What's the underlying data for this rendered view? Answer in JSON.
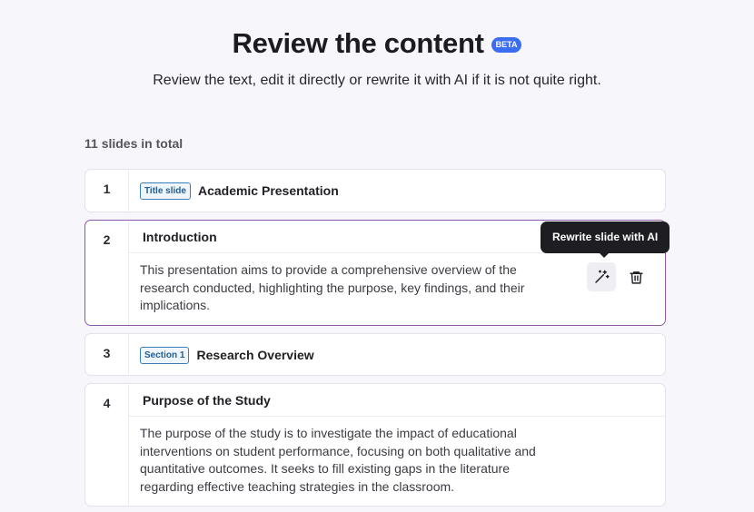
{
  "header": {
    "title": "Review the content",
    "badge": "BETA",
    "subtitle": "Review the text, edit it directly or rewrite it with AI if it is not quite right."
  },
  "slides_count": "11 slides in total",
  "tooltip": "Rewrite slide with AI",
  "slides": [
    {
      "number": "1",
      "tag": "Title slide",
      "title": "Academic Presentation"
    },
    {
      "number": "2",
      "title": "Introduction",
      "body": "This presentation aims to provide a comprehensive overview of the research conducted, highlighting the purpose, key findings, and their implications."
    },
    {
      "number": "3",
      "tag": "Section 1",
      "title": "Research Overview"
    },
    {
      "number": "4",
      "title": "Purpose of the Study",
      "body": "The purpose of the study is to investigate the impact of educational interventions on student performance, focusing on both qualitative and quantitative outcomes. It seeks to fill existing gaps in the literature regarding effective teaching strategies in the classroom."
    }
  ],
  "icons": {
    "rewrite": "magic-wand-icon",
    "delete": "trash-icon"
  }
}
